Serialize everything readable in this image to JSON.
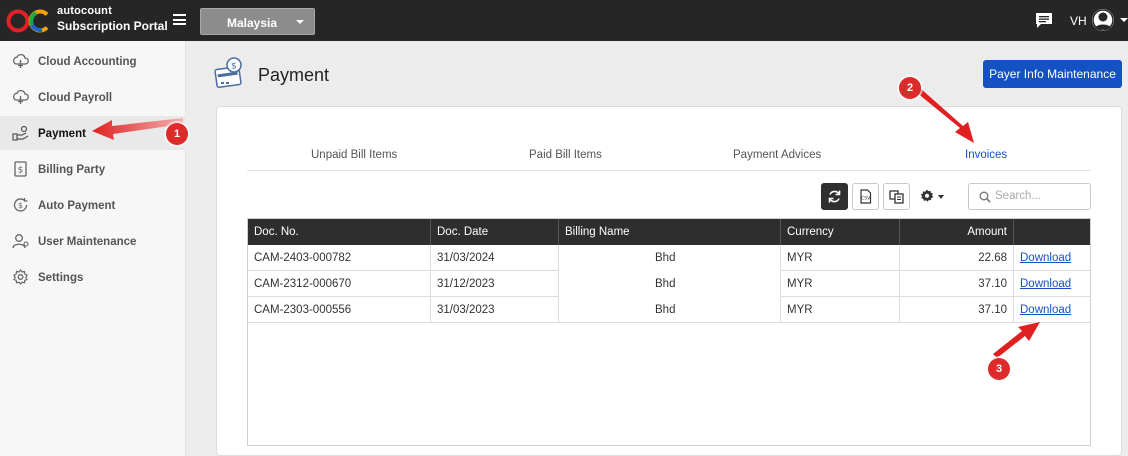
{
  "header": {
    "brand_line1": "autocount",
    "brand_line2": "Subscription Portal",
    "country": "Malaysia",
    "user_initials": "VH"
  },
  "sidebar": {
    "items": [
      {
        "label": "Cloud Accounting",
        "icon": "cloud-accounting-icon"
      },
      {
        "label": "Cloud Payroll",
        "icon": "cloud-payroll-icon"
      },
      {
        "label": "Payment",
        "icon": "payment-icon",
        "active": true
      },
      {
        "label": "Billing Party",
        "icon": "billing-party-icon"
      },
      {
        "label": "Auto Payment",
        "icon": "auto-payment-icon"
      },
      {
        "label": "User Maintenance",
        "icon": "user-maintenance-icon"
      },
      {
        "label": "Settings",
        "icon": "settings-icon"
      }
    ]
  },
  "page": {
    "title": "Payment",
    "payer_button": "Payer Info Maintenance"
  },
  "tabs": [
    {
      "label": "Unpaid Bill Items"
    },
    {
      "label": "Paid Bill Items"
    },
    {
      "label": "Payment Advices"
    },
    {
      "label": "Invoices",
      "active": true
    }
  ],
  "toolbar": {
    "search_placeholder": "Search..."
  },
  "table": {
    "columns": [
      "Doc. No.",
      "Doc. Date",
      "Billing Name",
      "Currency",
      "Amount",
      ""
    ],
    "rows": [
      {
        "doc_no": "CAM-2403-000782",
        "doc_date": "31/03/2024",
        "billing_name": "Bhd",
        "currency": "MYR",
        "amount": "22.68",
        "action": "Download"
      },
      {
        "doc_no": "CAM-2312-000670",
        "doc_date": "31/12/2023",
        "billing_name": "Bhd",
        "currency": "MYR",
        "amount": "37.10",
        "action": "Download"
      },
      {
        "doc_no": "CAM-2303-000556",
        "doc_date": "31/03/2023",
        "billing_name": "Bhd",
        "currency": "MYR",
        "amount": "37.10",
        "action": "Download"
      }
    ]
  },
  "annotations": [
    "1",
    "2",
    "3"
  ],
  "colors": {
    "accent": "#1452c4",
    "topbar": "#262626",
    "annotation": "#dd2a2a"
  }
}
